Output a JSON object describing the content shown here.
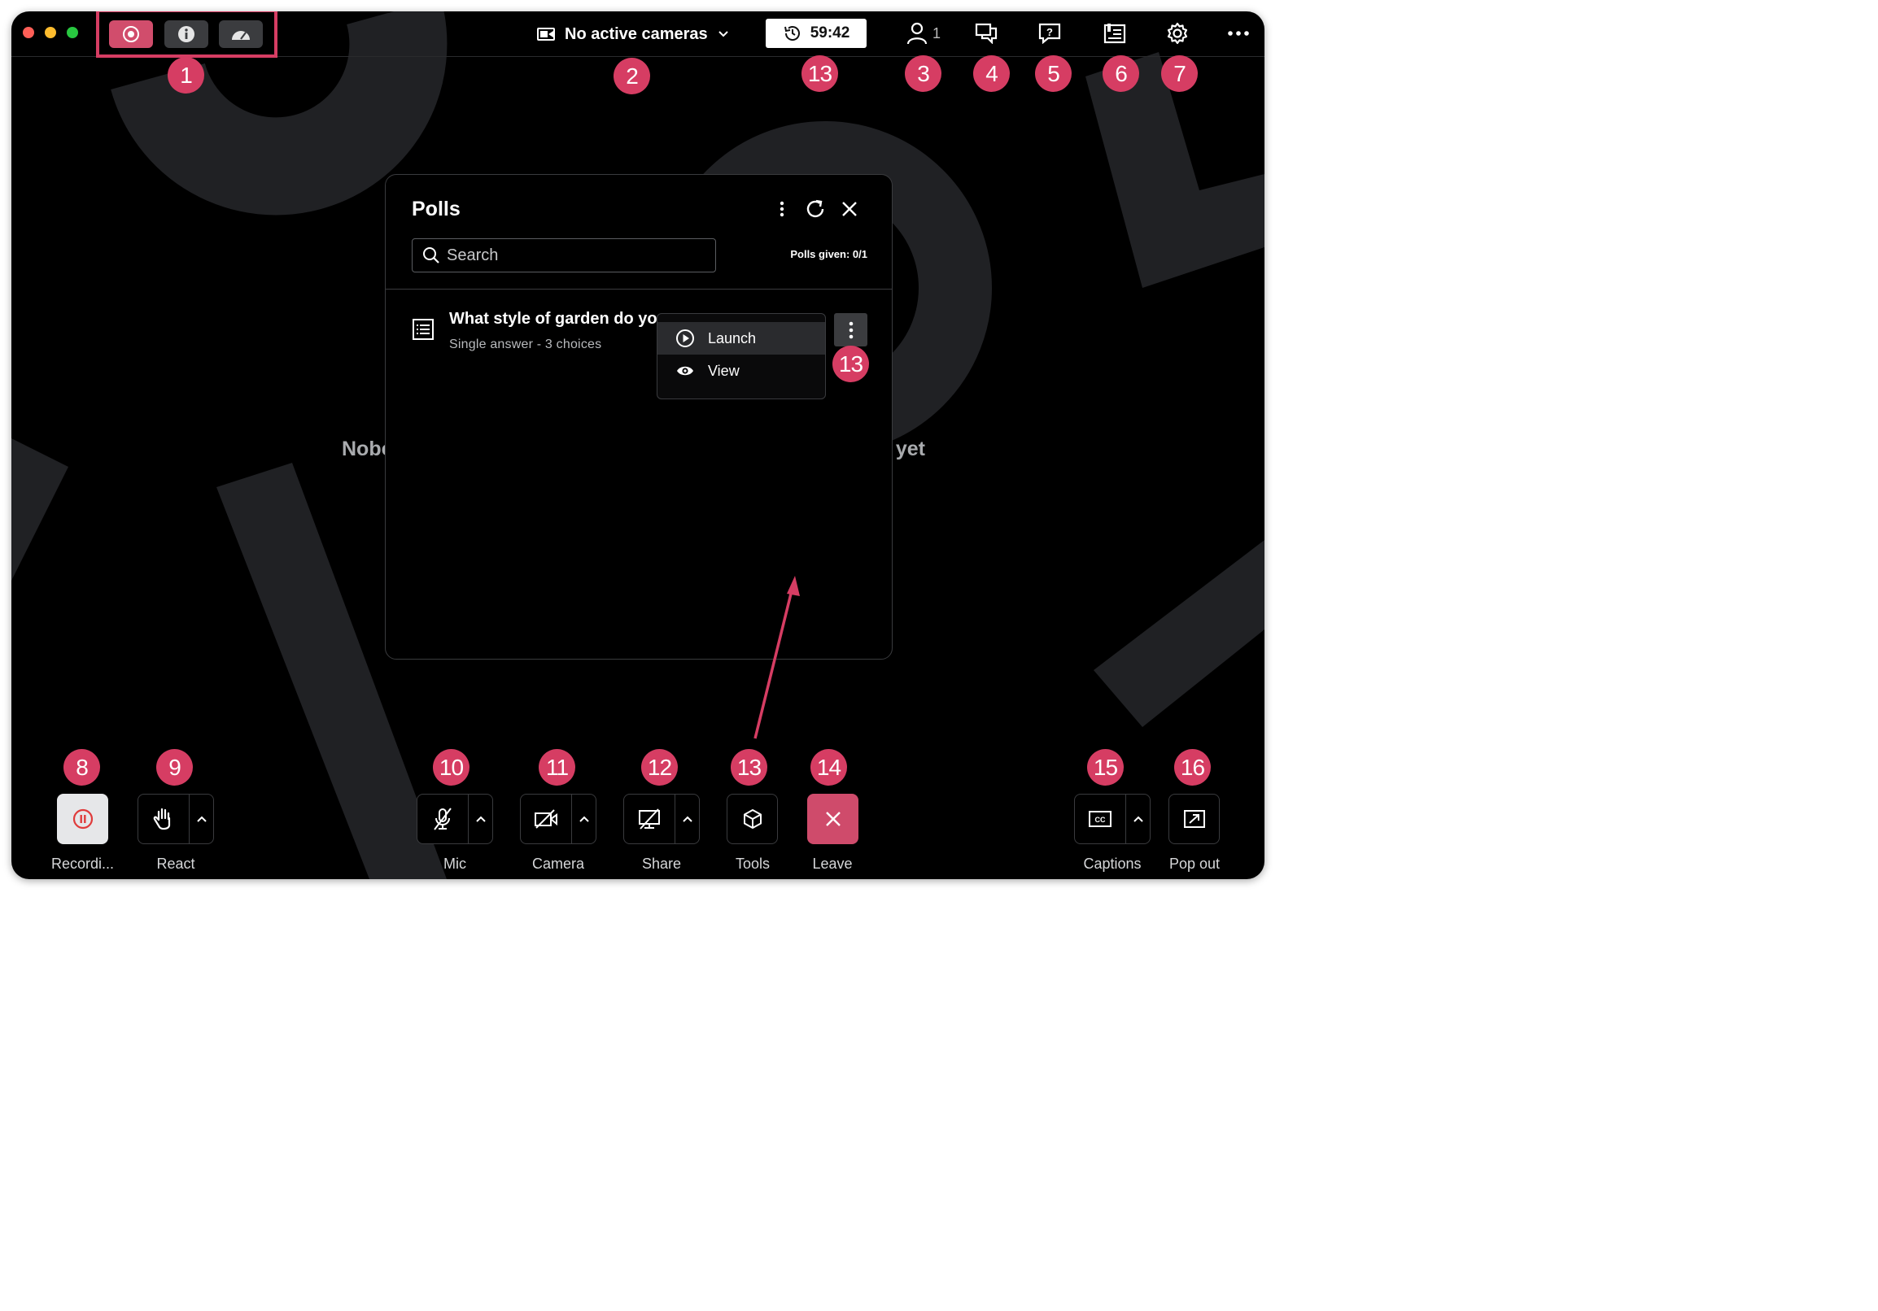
{
  "topbar": {
    "camera_select": "No active cameras",
    "timer": "59:42",
    "people_count": "1",
    "status_buttons": [
      "record-status-icon",
      "info-icon",
      "speedometer-icon"
    ],
    "icons": [
      "person-icon",
      "chat-icon",
      "qa-icon",
      "notes-icon",
      "gear-icon",
      "more-icon"
    ]
  },
  "stage": {
    "empty_left": "Nobo",
    "empty_right": "a yet"
  },
  "polls": {
    "title": "Polls",
    "search_placeholder": "Search",
    "polls_given": "Polls given: 0/1",
    "items": [
      {
        "question": "What style of garden do yo",
        "meta": "Single answer - 3 choices"
      }
    ],
    "menu": [
      "Launch",
      "View"
    ]
  },
  "controls": {
    "recording": "Recordi...",
    "react": "React",
    "mic": "Mic",
    "camera": "Camera",
    "share": "Share",
    "tools": "Tools",
    "leave": "Leave",
    "captions": "Captions",
    "popout": "Pop out"
  },
  "badges": {
    "b1": "1",
    "b2": "2",
    "b3": "3",
    "b4": "4",
    "b5": "5",
    "b6": "6",
    "b7": "7",
    "b8": "8",
    "b9": "9",
    "b10": "10",
    "b11": "11",
    "b12": "12",
    "b13": "13",
    "b14": "14",
    "b15": "15",
    "b16": "16"
  },
  "colors": {
    "accent": "#d63d63",
    "window_bg": "#000000",
    "deco": "#202124",
    "leave": "#cf4b6b"
  }
}
